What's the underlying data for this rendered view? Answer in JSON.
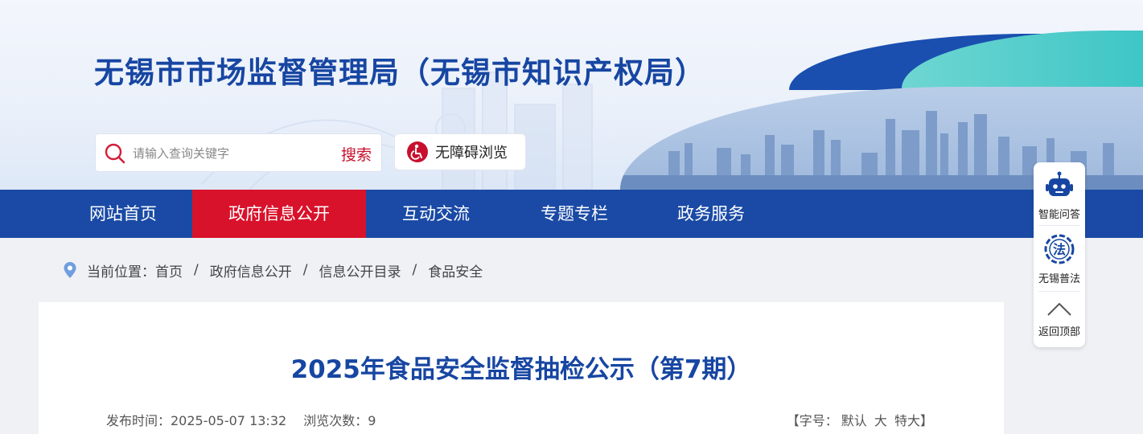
{
  "header": {
    "site_title": "无锡市市场监督管理局（无锡市知识产权局）",
    "search": {
      "placeholder": "请输入查询关键字",
      "button_label": "搜索"
    },
    "accessibility_label": "无障碍浏览"
  },
  "nav": {
    "items": [
      {
        "label": "网站首页",
        "active": false
      },
      {
        "label": "政府信息公开",
        "active": true
      },
      {
        "label": "互动交流",
        "active": false
      },
      {
        "label": "专题专栏",
        "active": false
      },
      {
        "label": "政务服务",
        "active": false
      }
    ]
  },
  "breadcrumb": {
    "prefix": "当前位置：",
    "items": [
      "首页",
      "政府信息公开",
      "信息公开目录",
      "食品安全"
    ],
    "separator": "/"
  },
  "article": {
    "title": "2025年食品安全监督抽检公示（第7期）",
    "publish_label": "发布时间：2025-05-07 13:32",
    "views_label": "浏览次数：9",
    "font_size": {
      "prefix": "【字号：",
      "options": [
        "默认",
        "大",
        "特大"
      ],
      "suffix": "】"
    }
  },
  "side_float": {
    "items": [
      {
        "label": "智能问答",
        "icon": "robot-icon"
      },
      {
        "label": "无锡普法",
        "icon": "law-icon"
      },
      {
        "label": "返回顶部",
        "icon": "chevron-up-icon"
      }
    ]
  },
  "colors": {
    "brand_blue": "#1a4aa5",
    "title_blue": "#1746a2",
    "active_red": "#d9122b",
    "search_red": "#c8102e"
  }
}
